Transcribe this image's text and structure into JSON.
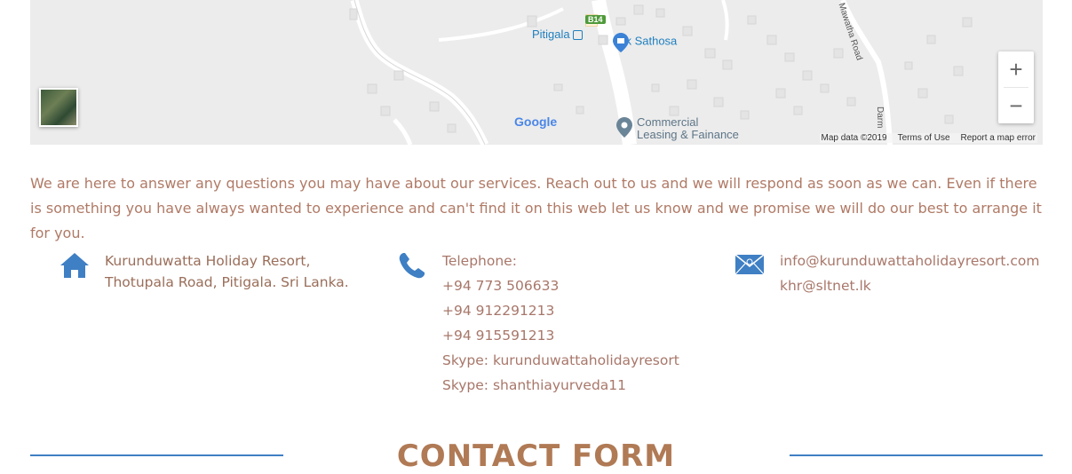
{
  "map": {
    "labels": {
      "place": "Pitigala",
      "road_shield": "B14",
      "poi1": "Lak Sathosa",
      "poi2_line1": "Commercial",
      "poi2_line2": "Leasing & Fainance",
      "road1": "Mawatha Road",
      "road2": "Darm"
    },
    "logo": "Google",
    "footer": {
      "map_data": "Map data ©2019",
      "terms": "Terms of Use",
      "report": "Report a map error"
    },
    "zoom_in": "+",
    "zoom_out": "−"
  },
  "intro_text": "We are here to answer any questions you may have about our services. Reach out to us and we will respond as soon as we can. Even if there is something you have always wanted to experience and can't find it on this web let us know and we promise we will do our best to arrange it for you.",
  "address": {
    "line1": "Kurunduwatta Holiday Resort,",
    "line2": "Thotupala Road, Pitigala. Sri Lanka."
  },
  "phone": {
    "label": "Telephone:",
    "numbers": [
      "+94 773 506633",
      "+94 912291213",
      "+94 915591213"
    ],
    "skype": [
      "Skype: kurunduwattaholidayresort",
      "Skype: shanthiayurveda11"
    ]
  },
  "email": {
    "addresses": [
      "info@kurunduwattaholidayresort.com",
      "khr@sltnet.lk"
    ]
  },
  "contact_form": {
    "title": "CONTACT FORM"
  },
  "colors": {
    "accent_blue": "#3f7fc4",
    "text_brown": "#b07a66"
  }
}
